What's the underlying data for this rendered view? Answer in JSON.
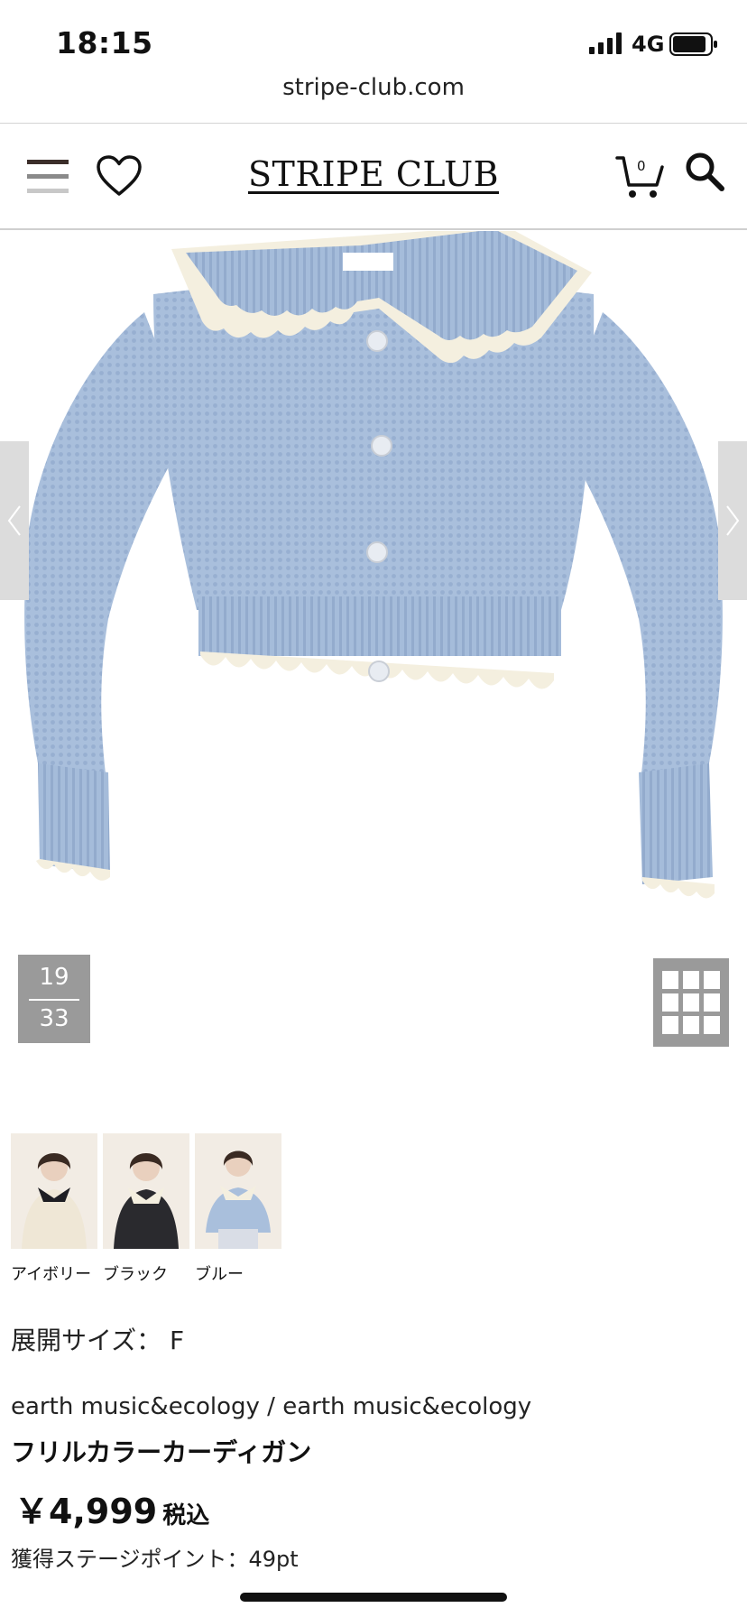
{
  "status_bar": {
    "time": "18:15",
    "network": "4G"
  },
  "browser": {
    "url": "stripe-club.com"
  },
  "header": {
    "logo": "STRIPE CLUB",
    "cart_count": "0"
  },
  "gallery": {
    "current": "19",
    "total": "33"
  },
  "colors": [
    {
      "label": "アイボリー",
      "swatch": "#efe7d6"
    },
    {
      "label": "ブラック",
      "swatch": "#2a2a2e"
    },
    {
      "label": "ブルー",
      "swatch": "#a9bfdc"
    }
  ],
  "product": {
    "size_line": "展開サイズ： F",
    "brand_line": "earth music&ecology  / earth music&ecology",
    "name": "フリルカラーカーディガン",
    "price": "￥4,999",
    "tax_label": "税込",
    "points_line": "獲得ステージポイント：49pt"
  },
  "theme": {
    "menu_bar_colors": [
      "#3b2e2a",
      "#8a8a8a",
      "#c8c8c8"
    ],
    "cardigan_color": "#a9bfdc",
    "trim_color": "#f4efdf",
    "counter_bg": "#9a9a9a"
  }
}
